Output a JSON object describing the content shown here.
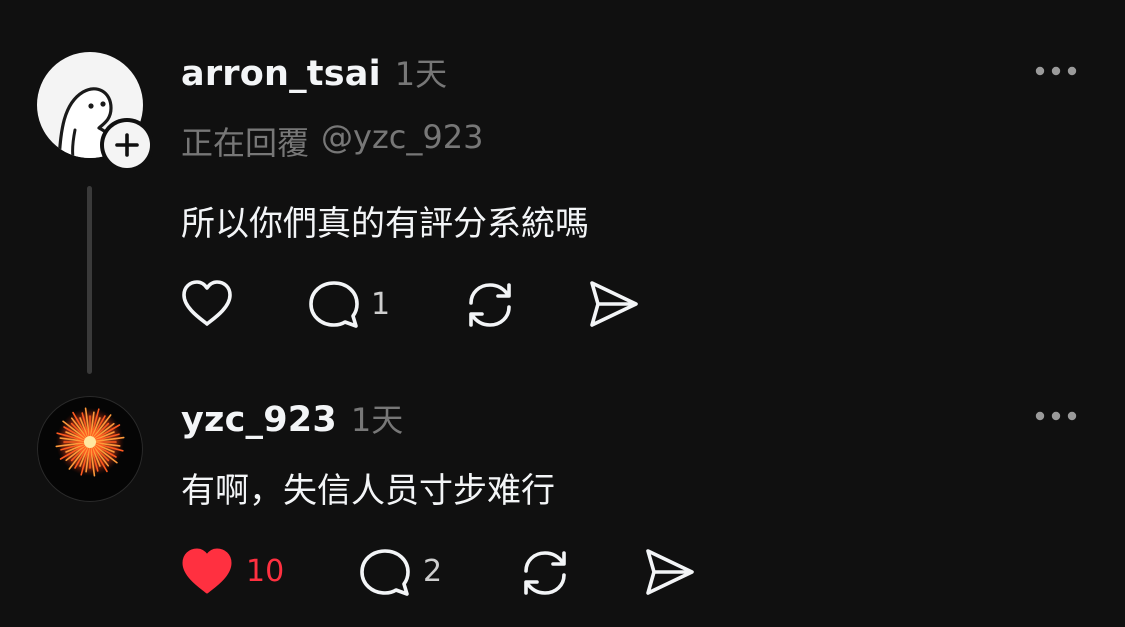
{
  "posts": [
    {
      "username": "arron_tsai",
      "time": "1天",
      "replying_prefix": "正在回覆",
      "replying_to": "@yzc_923",
      "text": "所以你們真的有評分系統嗎",
      "like_count": "",
      "reply_count": "1",
      "liked": false
    },
    {
      "username": "yzc_923",
      "time": "1天",
      "text": "有啊，失信人员寸步难行",
      "like_count": "10",
      "reply_count": "2",
      "liked": true
    }
  ],
  "icons": {
    "more": "more-horizontal-icon",
    "follow": "plus-icon",
    "like": "heart-icon",
    "reply": "comment-icon",
    "repost": "repost-icon",
    "share": "send-icon"
  },
  "colors": {
    "background": "#101010",
    "liked": "#ff3040",
    "muted": "#777777"
  }
}
